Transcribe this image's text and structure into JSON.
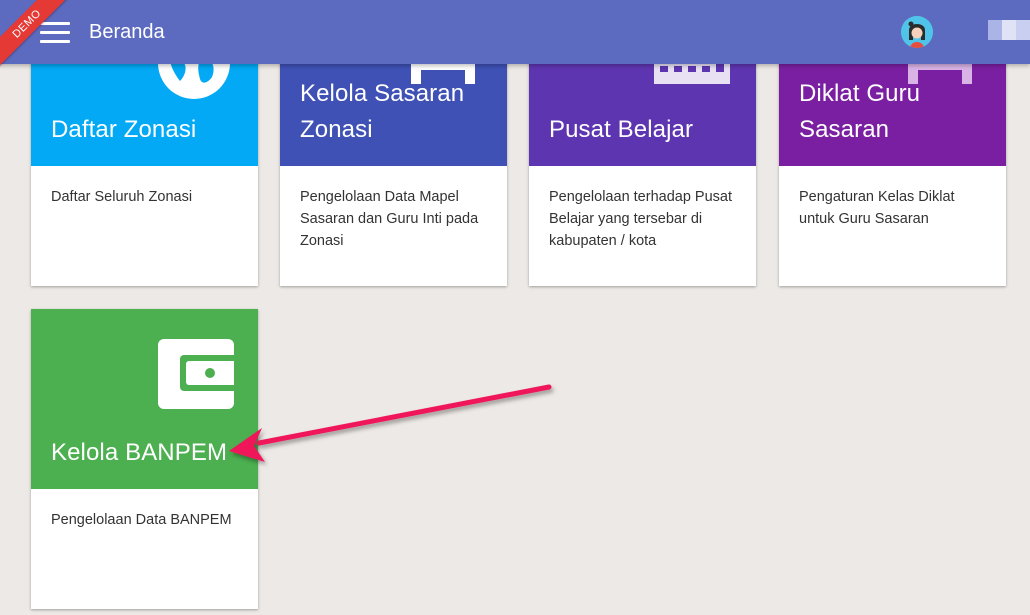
{
  "header": {
    "title": "Beranda",
    "ribbon_label": "DEMO",
    "color": "#5c6bc0"
  },
  "cards": [
    {
      "title": "Daftar Zonasi",
      "description": "Daftar Seluruh Zonasi",
      "color": "#03a9f4",
      "icon": "globe-icon"
    },
    {
      "title": "Kelola Sasaran Zonasi",
      "description": "Pengelolaan Data Mapel Sasaran dan Guru Inti pada Zonasi",
      "color": "#3f51b5",
      "icon": "school-icon"
    },
    {
      "title": "Pusat Belajar",
      "description": "Pengelolaan terhadap Pusat Belajar yang tersebar di kabupaten / kota",
      "color": "#5e35b1",
      "icon": "building-icon"
    },
    {
      "title": "Diklat Guru Sasaran",
      "description": "Pengaturan Kelas Diklat untuk Guru Sasaran",
      "color": "#7b1fa2",
      "icon": "school-icon"
    },
    {
      "title": "Kelola BANPEM",
      "description": "Pengelolaan Data BANPEM",
      "color": "#4caf50",
      "icon": "wallet-icon"
    }
  ],
  "annotation": {
    "arrow_color": "#f0145a",
    "points_to": "Kelola BANPEM"
  }
}
